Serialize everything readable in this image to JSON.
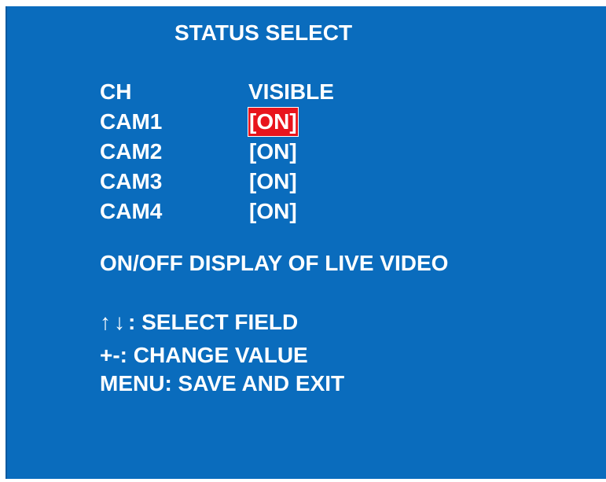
{
  "title": "STATUS SELECT",
  "header": {
    "ch_label": "CH",
    "visible_label": "VISIBLE"
  },
  "channels": [
    {
      "name": "CAM1",
      "value": "[ON]",
      "selected": true
    },
    {
      "name": "CAM2",
      "value": "[ON]",
      "selected": false
    },
    {
      "name": "CAM3",
      "value": "[ON]",
      "selected": false
    },
    {
      "name": "CAM4",
      "value": "[ON]",
      "selected": false
    }
  ],
  "description": "ON/OFF DISPLAY OF LIVE VIDEO",
  "help": {
    "up_arrow": "↑",
    "down_arrow": "↓",
    "select_field": ": SELECT FIELD",
    "change_value": "+-: CHANGE VALUE",
    "save_exit": "MENU: SAVE AND EXIT"
  },
  "colors": {
    "background": "#0a6cbd",
    "text": "#ffffff",
    "highlight": "#e8141c"
  }
}
